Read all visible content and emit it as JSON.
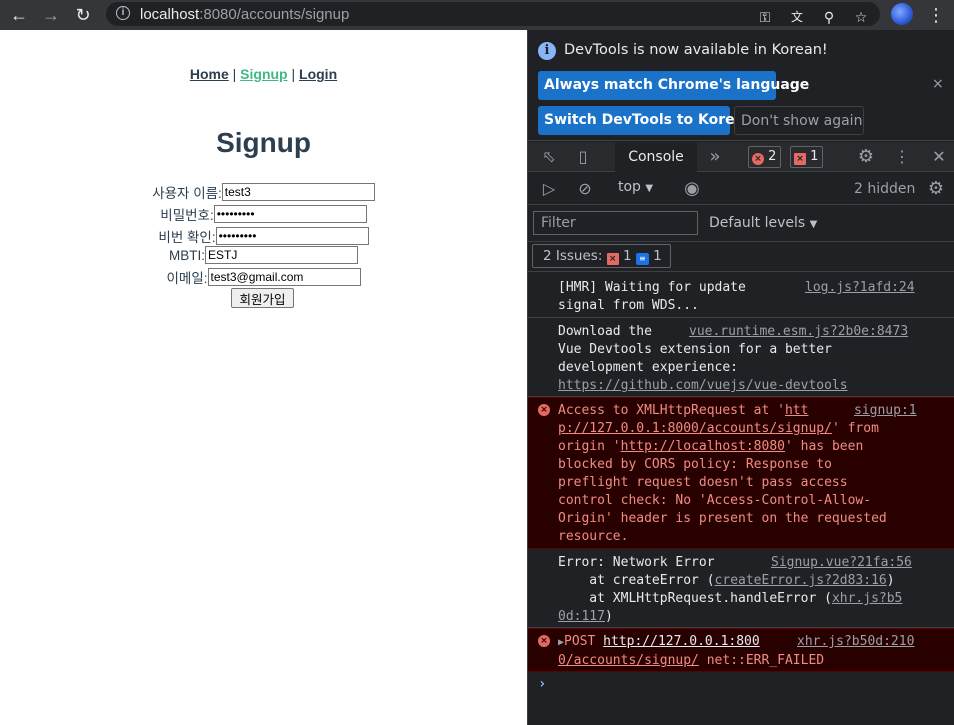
{
  "browser": {
    "url_host": "localhost",
    "url_rest": ":8080/accounts/signup",
    "back_icon": "arrow-left-icon",
    "forward_icon": "arrow-right-icon",
    "reload_icon": "reload-icon"
  },
  "page": {
    "nav": {
      "home": "Home",
      "signup": "Signup",
      "login": "Login",
      "separator": "|"
    },
    "title": "Signup",
    "form": {
      "username_label": "사용자 이름:",
      "username_value": "test3",
      "password_label": "비밀번호:",
      "password_value": "•••••••••",
      "password_confirm_label": "비번 확인:",
      "password_confirm_value": "•••••••••",
      "mbti_label": "MBTI:",
      "mbti_value": "ESTJ",
      "email_label": "이메일:",
      "email_value": "test3@gmail.com",
      "submit_label": "회원가입"
    }
  },
  "devtools": {
    "banner": {
      "text": "DevTools is now available in Korean!",
      "match_button": "Always match Chrome's language",
      "switch_button": "Switch DevTools to Korean",
      "dont_show_button": "Don't show again",
      "close": "×"
    },
    "tabs": {
      "console": "Console",
      "more": "»",
      "error_count": "2",
      "issue_count": "1"
    },
    "toolbar": {
      "context": "top",
      "hidden": "2 hidden"
    },
    "filter": {
      "placeholder": "Filter",
      "levels": "Default levels"
    },
    "issues": {
      "label": "2 Issues:",
      "errors": "1",
      "infos": "1"
    },
    "messages": {
      "hmr_text": "[HMR] Waiting for update\nsignal from WDS...",
      "hmr_src": "log.js?1afd:24",
      "vue_text_1": "Download the",
      "vue_text_2": "Vue Devtools extension for a better\ndevelopment experience:",
      "vue_link": "https://github.com/vuejs/vue-devtools",
      "vue_src": "vue.runtime.esm.js?2b0e:8473",
      "cors_pre": "Access to XMLHttpRequest at '",
      "cors_link_a": "htt",
      "cors_link_b": "p://127.0.0.1:8000/accounts/signup/",
      "cors_mid": "' from\norigin '",
      "cors_origin": "http://localhost:8080",
      "cors_post": "' has been\nblocked by CORS policy: Response to\npreflight request doesn't pass access\ncontrol check: No 'Access-Control-Allow-\nOrigin' header is present on the requested\nresource.",
      "cors_src": "signup:1",
      "neterr_line1": "Error: Network Error",
      "neterr_src": "Signup.vue?21fa:56",
      "neterr_line2": "    at createError (",
      "neterr_line2_link": "createError.js?2d83:16",
      "neterr_line2_end": ")",
      "neterr_line3": "    at XMLHttpRequest.handleError (",
      "neterr_line3_link_a": "xhr.js?b5",
      "neterr_line3_link_b": "0d:117",
      "neterr_line3_end": ")",
      "post_method": "POST",
      "post_link_a": "http://127.0.0.1:800",
      "post_link_b": "0/accounts/signup/",
      "post_status": " net::ERR_FAILED",
      "post_src": "xhr.js?b50d:210",
      "prompt": "›"
    }
  }
}
